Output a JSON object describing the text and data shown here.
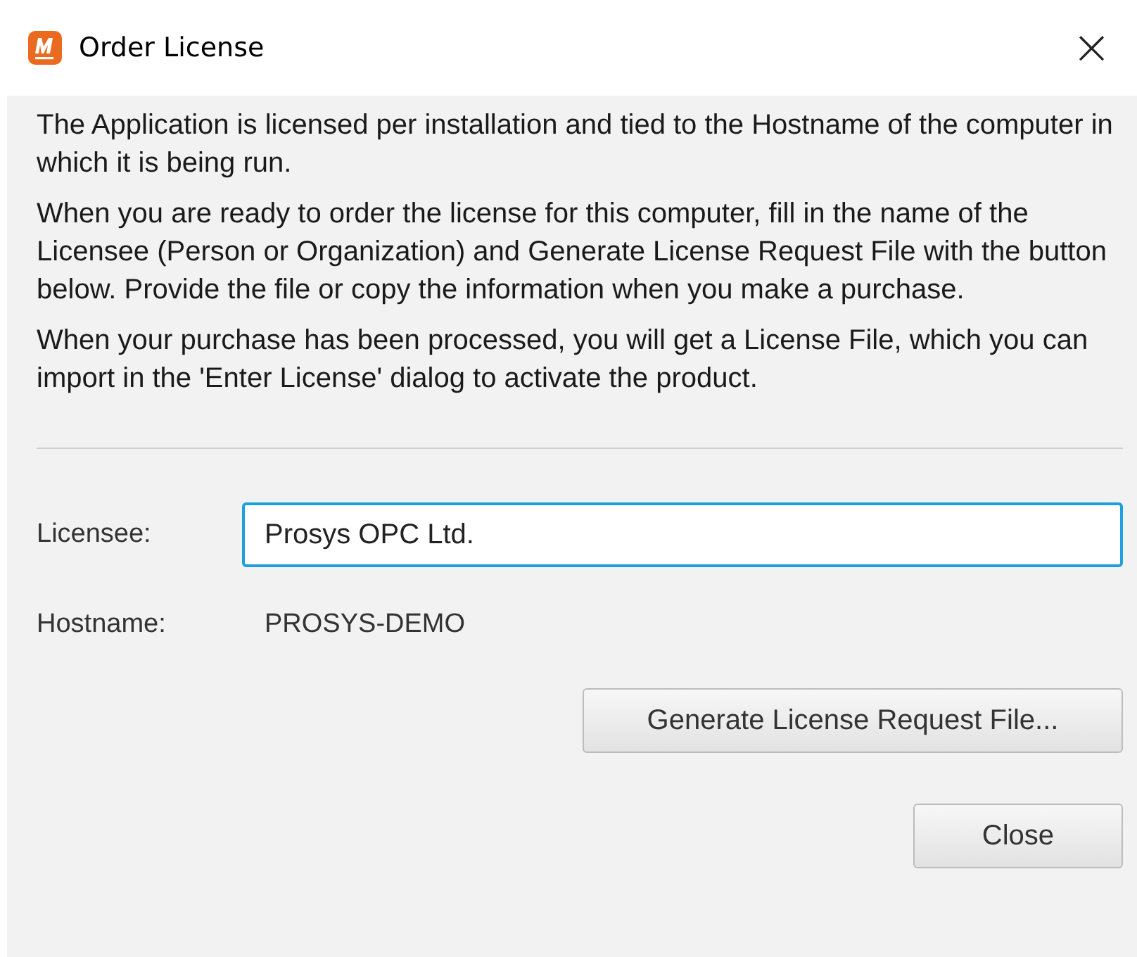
{
  "window": {
    "title": "Order License",
    "close": "×"
  },
  "paragraphs": [
    "The Application is licensed per installation and tied to the Hostname of the computer in which it is being run.",
    "When you are ready to order the license for this computer, fill in the name of the Licensee (Person or Organization) and Generate License Request File with the button below. Provide the file or copy the information when you make a purchase.",
    "When your purchase has been processed, you will get a License File, which you can import in the 'Enter License' dialog to activate the product."
  ],
  "licensee": {
    "label": "Licensee:",
    "value": "Prosys OPC Ltd.",
    "focused": true
  },
  "hostname": {
    "label": "Hostname:",
    "value": "PROSYS-DEMO"
  },
  "buttons": [
    "Generate License Request File...",
    "Close"
  ]
}
